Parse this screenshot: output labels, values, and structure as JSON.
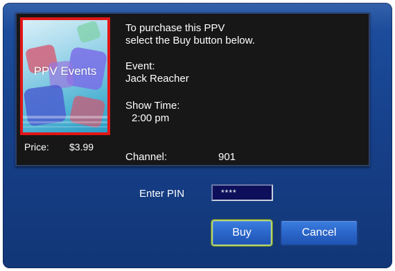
{
  "poster": {
    "title": "PPV Events"
  },
  "price": {
    "label": "Price:",
    "value": "$3.99"
  },
  "instructions": {
    "line1": "To purchase this PPV",
    "line2": "select the Buy button below."
  },
  "event": {
    "label": "Event:",
    "value": "Jack Reacher"
  },
  "show_time": {
    "label": "Show Time:",
    "value": "2:00 pm"
  },
  "channel": {
    "label": "Channel:",
    "value": "901"
  },
  "pin": {
    "label": "Enter PIN",
    "value": "****"
  },
  "buttons": {
    "buy": "Buy",
    "cancel": "Cancel"
  },
  "colors": {
    "dialog_background": "#17418b",
    "panel_background": "#171717",
    "poster_border": "#e01616",
    "focus_highlight": "#b6d66a",
    "button_blue": "#2b66c9",
    "pin_field": "#0d0f5a"
  }
}
